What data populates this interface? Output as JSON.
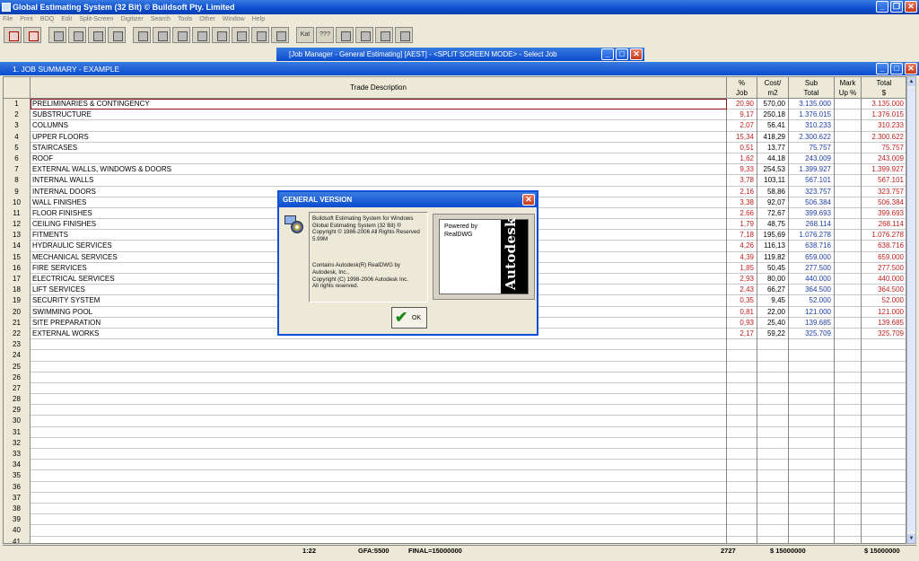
{
  "app": {
    "title": "Global Estimating System (32 Bit) © Buildsoft Pty. Limited",
    "menu": [
      "File",
      "Print",
      "BOQ",
      "Edit",
      "Split-Screen",
      "Digitizer",
      "Search",
      "Tools",
      "Other",
      "Window",
      "Help"
    ]
  },
  "toolbar": {
    "txt1": "Kat",
    "txt2": "???"
  },
  "job_manager": {
    "title": "[Job Manager - General Estimating] [AEST] - <SPLIT SCREEN MODE> - Select Job"
  },
  "summary_window": {
    "title": "1. JOB SUMMARY - EXAMPLE"
  },
  "columns": {
    "desc": "Trade Description",
    "pct": [
      "%",
      "Job"
    ],
    "cost": [
      "Cost/",
      "m2"
    ],
    "sub": [
      "Sub",
      "Total"
    ],
    "mark": [
      "Mark",
      "Up %"
    ],
    "tot": [
      "Total",
      "$"
    ]
  },
  "rows": [
    {
      "n": "1",
      "desc": "PRELIMINARIES & CONTINGENCY",
      "pct": "20,90",
      "cost": "570,00",
      "sub": "3.135.000",
      "tot": "3.135.000"
    },
    {
      "n": "2",
      "desc": "SUBSTRUCTURE",
      "pct": "9,17",
      "cost": "250,18",
      "sub": "1.376.015",
      "tot": "1.376.015"
    },
    {
      "n": "3",
      "desc": "COLUMNS",
      "pct": "2,07",
      "cost": "56,41",
      "sub": "310.233",
      "tot": "310.233"
    },
    {
      "n": "4",
      "desc": "UPPER FLOORS",
      "pct": "15,34",
      "cost": "418,29",
      "sub": "2.300.622",
      "tot": "2.300.622"
    },
    {
      "n": "5",
      "desc": "STAIRCASES",
      "pct": "0,51",
      "cost": "13,77",
      "sub": "75.757",
      "tot": "75.757"
    },
    {
      "n": "6",
      "desc": "ROOF",
      "pct": "1,62",
      "cost": "44,18",
      "sub": "243.009",
      "tot": "243.009"
    },
    {
      "n": "7",
      "desc": "EXTERNAL WALLS, WINDOWS & DOORS",
      "pct": "9,33",
      "cost": "254,53",
      "sub": "1.399.927",
      "tot": "1.399.927"
    },
    {
      "n": "8",
      "desc": "INTERNAL WALLS",
      "pct": "3,78",
      "cost": "103,11",
      "sub": "567.101",
      "tot": "567.101"
    },
    {
      "n": "9",
      "desc": "INTERNAL DOORS",
      "pct": "2,16",
      "cost": "58,86",
      "sub": "323.757",
      "tot": "323.757"
    },
    {
      "n": "10",
      "desc": "WALL FINISHES",
      "pct": "3,38",
      "cost": "92,07",
      "sub": "506.384",
      "tot": "506.384"
    },
    {
      "n": "11",
      "desc": "FLOOR FINISHES",
      "pct": "2,66",
      "cost": "72,67",
      "sub": "399.693",
      "tot": "399.693"
    },
    {
      "n": "12",
      "desc": "CEILING FINISHES",
      "pct": "1,79",
      "cost": "48,75",
      "sub": "268.114",
      "tot": "268.114"
    },
    {
      "n": "13",
      "desc": "FITMENTS",
      "pct": "7,18",
      "cost": "195,69",
      "sub": "1.076.278",
      "tot": "1.076.278"
    },
    {
      "n": "14",
      "desc": "HYDRAULIC SERVICES",
      "pct": "4,26",
      "cost": "116,13",
      "sub": "638.716",
      "tot": "638.716"
    },
    {
      "n": "15",
      "desc": "MECHANICAL SERVICES",
      "pct": "4,39",
      "cost": "119,82",
      "sub": "659.000",
      "tot": "659.000"
    },
    {
      "n": "16",
      "desc": "FIRE SERVICES",
      "pct": "1,85",
      "cost": "50,45",
      "sub": "277.500",
      "tot": "277.500"
    },
    {
      "n": "17",
      "desc": "ELECTRICAL SERVICES",
      "pct": "2,93",
      "cost": "80,00",
      "sub": "440.000",
      "tot": "440.000"
    },
    {
      "n": "18",
      "desc": "LIFT SERVICES",
      "pct": "2,43",
      "cost": "66,27",
      "sub": "364.500",
      "tot": "364.500"
    },
    {
      "n": "19",
      "desc": "SECURITY SYSTEM",
      "pct": "0,35",
      "cost": "9,45",
      "sub": "52.000",
      "tot": "52.000"
    },
    {
      "n": "20",
      "desc": "SWIMMING POOL",
      "pct": "0,81",
      "cost": "22,00",
      "sub": "121.000",
      "tot": "121.000"
    },
    {
      "n": "21",
      "desc": "SITE PREPARATION",
      "pct": "0,93",
      "cost": "25,40",
      "sub": "139.685",
      "tot": "139.685"
    },
    {
      "n": "22",
      "desc": "EXTERNAL WORKS",
      "pct": "2,17",
      "cost": "59,22",
      "sub": "325.709",
      "tot": "325.709"
    }
  ],
  "empty_rows": [
    "23",
    "24",
    "25",
    "26",
    "27",
    "28",
    "29",
    "30",
    "31",
    "32",
    "33",
    "34",
    "35",
    "36",
    "37",
    "38",
    "39",
    "40",
    "41"
  ],
  "status": {
    "ratio": "1:22",
    "gfa": "GFA:5500",
    "final": "FINAL=15000000",
    "cost": "2727",
    "sub_total": "$ 15000000",
    "total": "$ 15000000"
  },
  "dialog": {
    "title": "GENERAL VERSION",
    "lines1": [
      "Buildsoft Estimating System for Windows",
      " Global Estimating System (32 Bit) ®",
      "Copyright © 1986-2006 All Rights Reserved",
      "5.99M"
    ],
    "lines2": [
      "Contains Autodesk(R) RealDWG by",
      "Autodesk, Inc.,",
      "Copyright (C) 1998-2006 Autodesk Inc.",
      "All rights reserved."
    ],
    "powered": [
      "Powered by",
      "RealDWG"
    ],
    "brand": "Autodesk",
    "ok": "OK"
  }
}
